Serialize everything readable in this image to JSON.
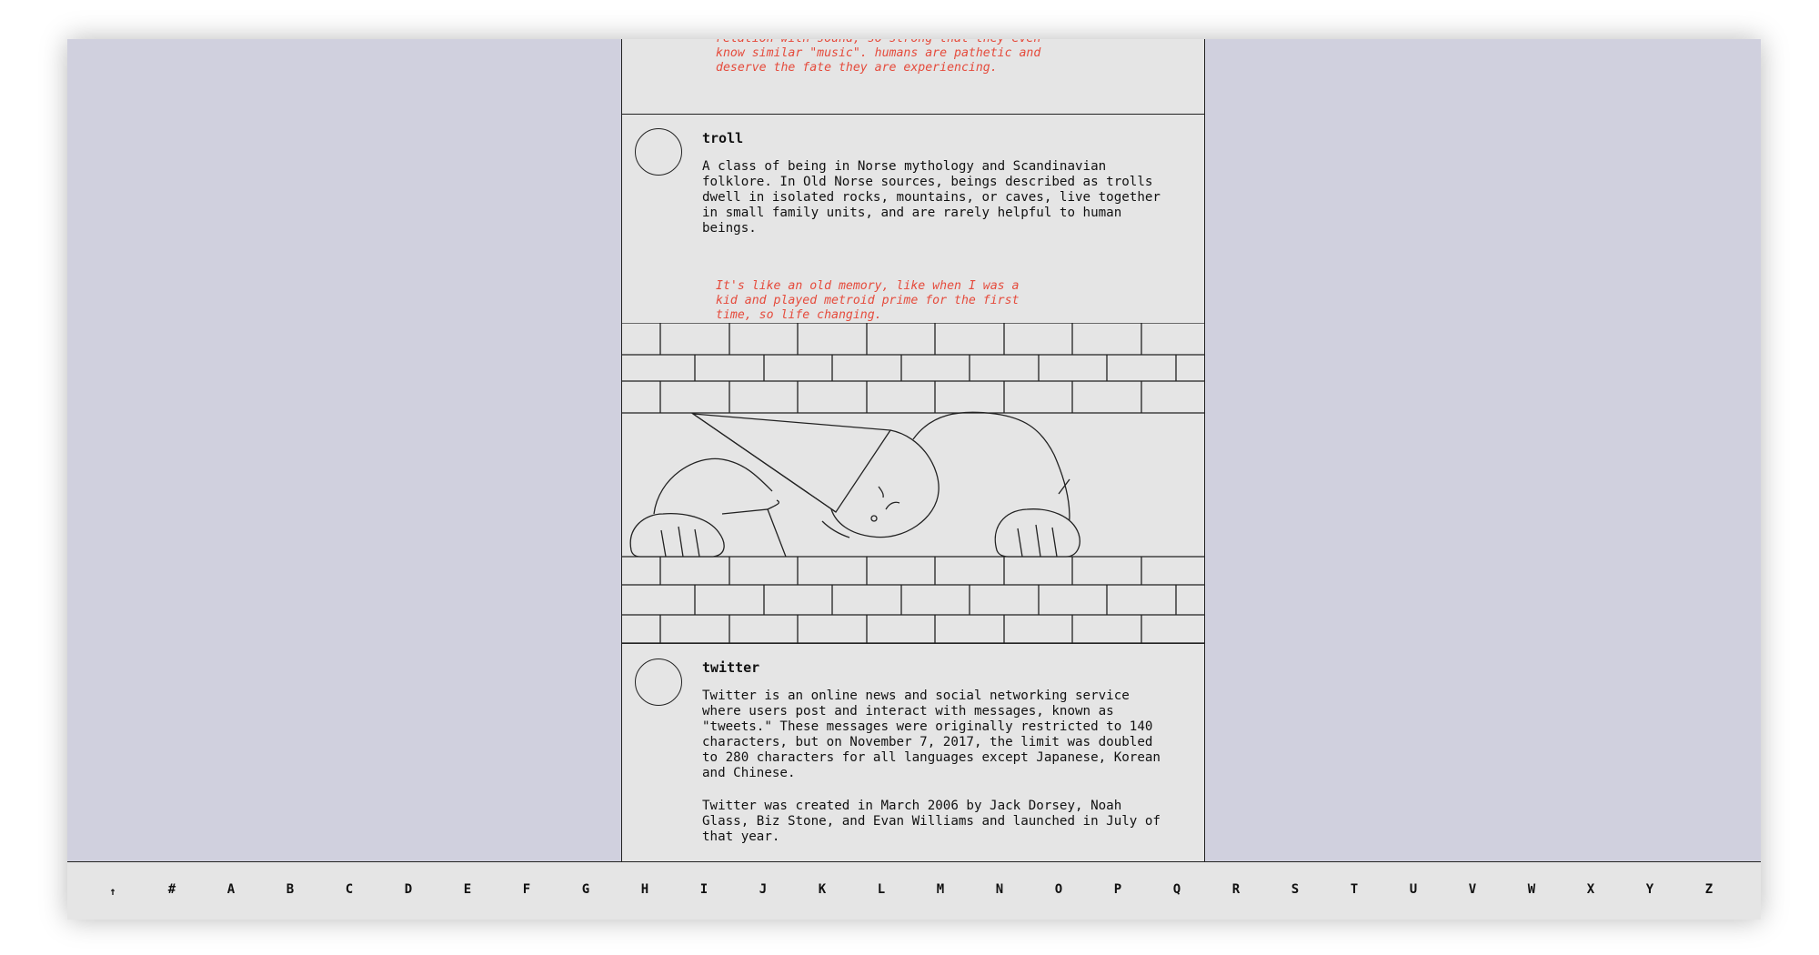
{
  "entries": {
    "previous": {
      "comment": "relation with sound, so strong that they even know similar \"music\". humans are pathetic and deserve the fate they are experiencing."
    },
    "troll": {
      "term": "troll",
      "definition": "A class of being in Norse mythology and Scandinavian folklore. In Old Norse sources, beings described as trolls dwell in isolated rocks, mountains, or caves, live together in small family units, and are rarely helpful to human beings.",
      "comment": "It's like an old memory, like when I was a kid and played metroid prime for the first time, so life changing."
    },
    "twitter": {
      "term": "twitter",
      "definition_1": "Twitter is an online news and social networking service where users post and interact with messages, known as \"tweets.\" These messages were originally restricted to 140 characters, but on November 7, 2017, the limit was doubled to 280 characters for all languages except Japanese, Korean and Chinese.",
      "definition_2": "Twitter was created in March 2006 by Jack Dorsey, Noah Glass, Biz Stone, and Evan Williams and launched in July of that year."
    }
  },
  "alphabet_nav": {
    "up": "↑",
    "letters": [
      "#",
      "A",
      "B",
      "C",
      "D",
      "E",
      "F",
      "G",
      "H",
      "I",
      "J",
      "K",
      "L",
      "M",
      "N",
      "O",
      "P",
      "Q",
      "R",
      "S",
      "T",
      "U",
      "V",
      "W",
      "X",
      "Y",
      "Z"
    ]
  },
  "colors": {
    "background": "#d0d0de",
    "panel": "#e5e5e5",
    "comment": "#e54b3c",
    "ink": "#222222"
  }
}
